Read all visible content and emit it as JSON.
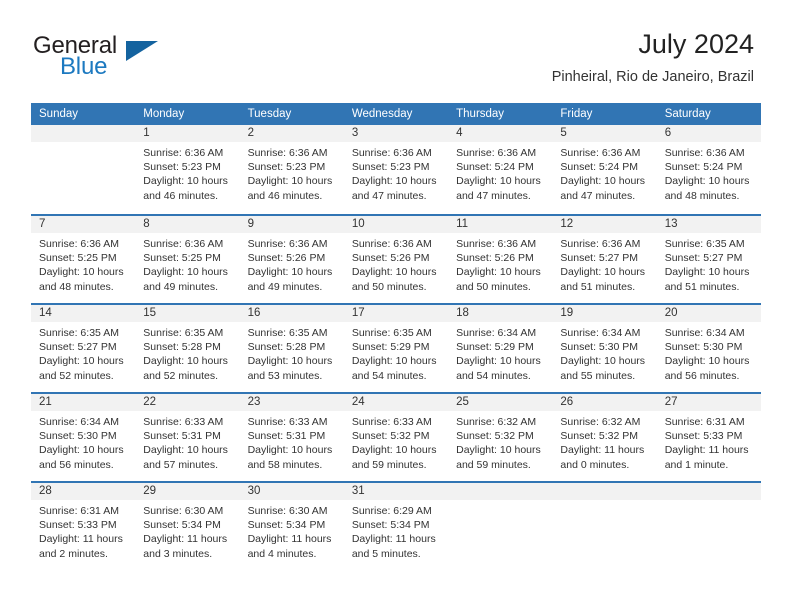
{
  "logo": {
    "text_primary": "General",
    "text_secondary": "Blue",
    "triangle_color": "#14639f",
    "blue_color": "#1c79c0"
  },
  "header": {
    "title": "July 2024",
    "subtitle": "Pinheiral, Rio de Janeiro, Brazil"
  },
  "theme": {
    "header_blue": "#3175b4",
    "daynum_band": "#f2f2f2",
    "text": "#333333"
  },
  "weekdays": [
    "Sunday",
    "Monday",
    "Tuesday",
    "Wednesday",
    "Thursday",
    "Friday",
    "Saturday"
  ],
  "weeks": [
    [
      {
        "day": "",
        "lines": []
      },
      {
        "day": "1",
        "lines": [
          "Sunrise: 6:36 AM",
          "Sunset: 5:23 PM",
          "Daylight: 10 hours",
          "and 46 minutes."
        ]
      },
      {
        "day": "2",
        "lines": [
          "Sunrise: 6:36 AM",
          "Sunset: 5:23 PM",
          "Daylight: 10 hours",
          "and 46 minutes."
        ]
      },
      {
        "day": "3",
        "lines": [
          "Sunrise: 6:36 AM",
          "Sunset: 5:23 PM",
          "Daylight: 10 hours",
          "and 47 minutes."
        ]
      },
      {
        "day": "4",
        "lines": [
          "Sunrise: 6:36 AM",
          "Sunset: 5:24 PM",
          "Daylight: 10 hours",
          "and 47 minutes."
        ]
      },
      {
        "day": "5",
        "lines": [
          "Sunrise: 6:36 AM",
          "Sunset: 5:24 PM",
          "Daylight: 10 hours",
          "and 47 minutes."
        ]
      },
      {
        "day": "6",
        "lines": [
          "Sunrise: 6:36 AM",
          "Sunset: 5:24 PM",
          "Daylight: 10 hours",
          "and 48 minutes."
        ]
      }
    ],
    [
      {
        "day": "7",
        "lines": [
          "Sunrise: 6:36 AM",
          "Sunset: 5:25 PM",
          "Daylight: 10 hours",
          "and 48 minutes."
        ]
      },
      {
        "day": "8",
        "lines": [
          "Sunrise: 6:36 AM",
          "Sunset: 5:25 PM",
          "Daylight: 10 hours",
          "and 49 minutes."
        ]
      },
      {
        "day": "9",
        "lines": [
          "Sunrise: 6:36 AM",
          "Sunset: 5:26 PM",
          "Daylight: 10 hours",
          "and 49 minutes."
        ]
      },
      {
        "day": "10",
        "lines": [
          "Sunrise: 6:36 AM",
          "Sunset: 5:26 PM",
          "Daylight: 10 hours",
          "and 50 minutes."
        ]
      },
      {
        "day": "11",
        "lines": [
          "Sunrise: 6:36 AM",
          "Sunset: 5:26 PM",
          "Daylight: 10 hours",
          "and 50 minutes."
        ]
      },
      {
        "day": "12",
        "lines": [
          "Sunrise: 6:36 AM",
          "Sunset: 5:27 PM",
          "Daylight: 10 hours",
          "and 51 minutes."
        ]
      },
      {
        "day": "13",
        "lines": [
          "Sunrise: 6:35 AM",
          "Sunset: 5:27 PM",
          "Daylight: 10 hours",
          "and 51 minutes."
        ]
      }
    ],
    [
      {
        "day": "14",
        "lines": [
          "Sunrise: 6:35 AM",
          "Sunset: 5:27 PM",
          "Daylight: 10 hours",
          "and 52 minutes."
        ]
      },
      {
        "day": "15",
        "lines": [
          "Sunrise: 6:35 AM",
          "Sunset: 5:28 PM",
          "Daylight: 10 hours",
          "and 52 minutes."
        ]
      },
      {
        "day": "16",
        "lines": [
          "Sunrise: 6:35 AM",
          "Sunset: 5:28 PM",
          "Daylight: 10 hours",
          "and 53 minutes."
        ]
      },
      {
        "day": "17",
        "lines": [
          "Sunrise: 6:35 AM",
          "Sunset: 5:29 PM",
          "Daylight: 10 hours",
          "and 54 minutes."
        ]
      },
      {
        "day": "18",
        "lines": [
          "Sunrise: 6:34 AM",
          "Sunset: 5:29 PM",
          "Daylight: 10 hours",
          "and 54 minutes."
        ]
      },
      {
        "day": "19",
        "lines": [
          "Sunrise: 6:34 AM",
          "Sunset: 5:30 PM",
          "Daylight: 10 hours",
          "and 55 minutes."
        ]
      },
      {
        "day": "20",
        "lines": [
          "Sunrise: 6:34 AM",
          "Sunset: 5:30 PM",
          "Daylight: 10 hours",
          "and 56 minutes."
        ]
      }
    ],
    [
      {
        "day": "21",
        "lines": [
          "Sunrise: 6:34 AM",
          "Sunset: 5:30 PM",
          "Daylight: 10 hours",
          "and 56 minutes."
        ]
      },
      {
        "day": "22",
        "lines": [
          "Sunrise: 6:33 AM",
          "Sunset: 5:31 PM",
          "Daylight: 10 hours",
          "and 57 minutes."
        ]
      },
      {
        "day": "23",
        "lines": [
          "Sunrise: 6:33 AM",
          "Sunset: 5:31 PM",
          "Daylight: 10 hours",
          "and 58 minutes."
        ]
      },
      {
        "day": "24",
        "lines": [
          "Sunrise: 6:33 AM",
          "Sunset: 5:32 PM",
          "Daylight: 10 hours",
          "and 59 minutes."
        ]
      },
      {
        "day": "25",
        "lines": [
          "Sunrise: 6:32 AM",
          "Sunset: 5:32 PM",
          "Daylight: 10 hours",
          "and 59 minutes."
        ]
      },
      {
        "day": "26",
        "lines": [
          "Sunrise: 6:32 AM",
          "Sunset: 5:32 PM",
          "Daylight: 11 hours",
          "and 0 minutes."
        ]
      },
      {
        "day": "27",
        "lines": [
          "Sunrise: 6:31 AM",
          "Sunset: 5:33 PM",
          "Daylight: 11 hours",
          "and 1 minute."
        ]
      }
    ],
    [
      {
        "day": "28",
        "lines": [
          "Sunrise: 6:31 AM",
          "Sunset: 5:33 PM",
          "Daylight: 11 hours",
          "and 2 minutes."
        ]
      },
      {
        "day": "29",
        "lines": [
          "Sunrise: 6:30 AM",
          "Sunset: 5:34 PM",
          "Daylight: 11 hours",
          "and 3 minutes."
        ]
      },
      {
        "day": "30",
        "lines": [
          "Sunrise: 6:30 AM",
          "Sunset: 5:34 PM",
          "Daylight: 11 hours",
          "and 4 minutes."
        ]
      },
      {
        "day": "31",
        "lines": [
          "Sunrise: 6:29 AM",
          "Sunset: 5:34 PM",
          "Daylight: 11 hours",
          "and 5 minutes."
        ]
      },
      {
        "day": "",
        "lines": []
      },
      {
        "day": "",
        "lines": []
      },
      {
        "day": "",
        "lines": []
      }
    ]
  ]
}
